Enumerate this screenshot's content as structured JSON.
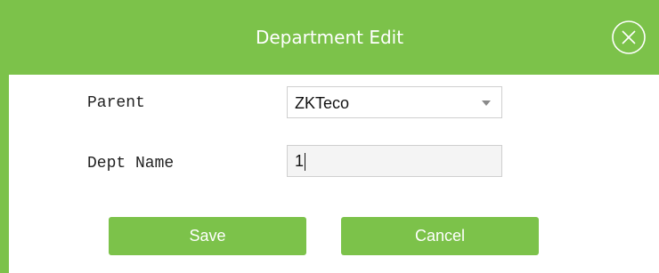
{
  "dialog": {
    "title": "Department Edit",
    "close_icon": "close-circle-icon",
    "accent_color": "#7cc24a"
  },
  "form": {
    "parent_label": "Parent",
    "parent_value": "ZKTeco",
    "dept_name_label": "Dept Name",
    "dept_name_value": "1"
  },
  "buttons": {
    "save_label": "Save",
    "cancel_label": "Cancel"
  }
}
